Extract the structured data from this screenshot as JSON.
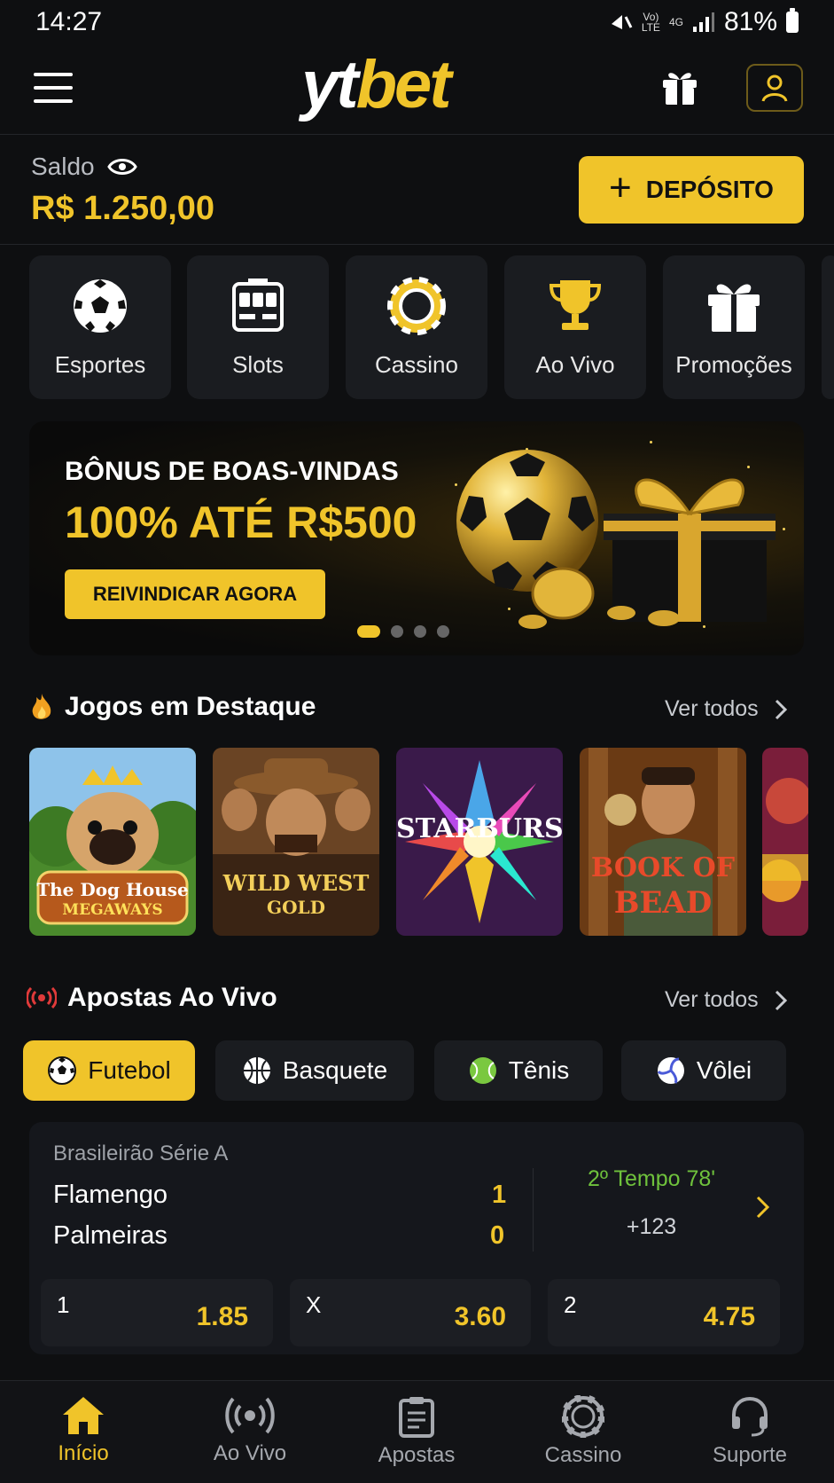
{
  "status_bar": {
    "time": "14:27",
    "net_top": "Vo)",
    "net_bottom": "LTE",
    "signal_type": "4G",
    "battery": "81%"
  },
  "header": {
    "logo_part1": "yt",
    "logo_part2": "bet"
  },
  "balance": {
    "label": "Saldo",
    "value": "R$ 1.250,00",
    "deposit_label": "DEPÓSITO"
  },
  "categories": [
    {
      "label": "Esportes",
      "icon": "soccer-ball-icon"
    },
    {
      "label": "Slots",
      "icon": "slot-machine-icon"
    },
    {
      "label": "Cassino",
      "icon": "casino-chip-icon"
    },
    {
      "label": "Ao Vivo",
      "icon": "trophy-icon"
    },
    {
      "label": "Promoções",
      "icon": "gift-icon"
    }
  ],
  "banner": {
    "subtitle": "BÔNUS DE BOAS-VINDAS",
    "title": "100% ATÉ R$500",
    "cta": "REIVINDICAR AGORA",
    "dots": 4,
    "active_dot": 0
  },
  "featured": {
    "title": "Jogos em Destaque",
    "see_all": "Ver todos",
    "games": [
      {
        "line1": "The Dog House",
        "line2": "MEGAWAYS"
      },
      {
        "line1": "WILD WEST",
        "line2": "GOLD"
      },
      {
        "line1": "STARBURST",
        "line2": ""
      },
      {
        "line1": "BOOK OF",
        "line2": "BEAD"
      },
      {
        "line1": "",
        "line2": ""
      }
    ]
  },
  "live": {
    "title": "Apostas Ao Vivo",
    "see_all": "Ver todos",
    "tabs": [
      {
        "label": "Futebol",
        "active": true
      },
      {
        "label": "Basquete",
        "active": false
      },
      {
        "label": "Tênis",
        "active": false
      },
      {
        "label": "Vôlei",
        "active": false
      }
    ],
    "match": {
      "league": "Brasileirão Série A",
      "home": "Flamengo",
      "home_score": "1",
      "away": "Palmeiras",
      "away_score": "0",
      "time": "2º Tempo 78'",
      "more_markets": "+123",
      "odds": [
        {
          "key": "1",
          "value": "1.85"
        },
        {
          "key": "X",
          "value": "3.60"
        },
        {
          "key": "2",
          "value": "4.75"
        }
      ]
    }
  },
  "bottom_nav": [
    {
      "label": "Início",
      "icon": "home-icon",
      "active": true
    },
    {
      "label": "Ao Vivo",
      "icon": "live-broadcast-icon",
      "active": false
    },
    {
      "label": "Apostas",
      "icon": "betslip-icon",
      "active": false
    },
    {
      "label": "Cassino",
      "icon": "casino-chip-icon",
      "active": false
    },
    {
      "label": "Suporte",
      "icon": "headset-icon",
      "active": false
    }
  ],
  "colors": {
    "accent": "#f0c42a",
    "background": "#0e0f11",
    "card": "#1a1c20",
    "live_green": "#6fc23c",
    "live_red": "#e03a3a"
  }
}
